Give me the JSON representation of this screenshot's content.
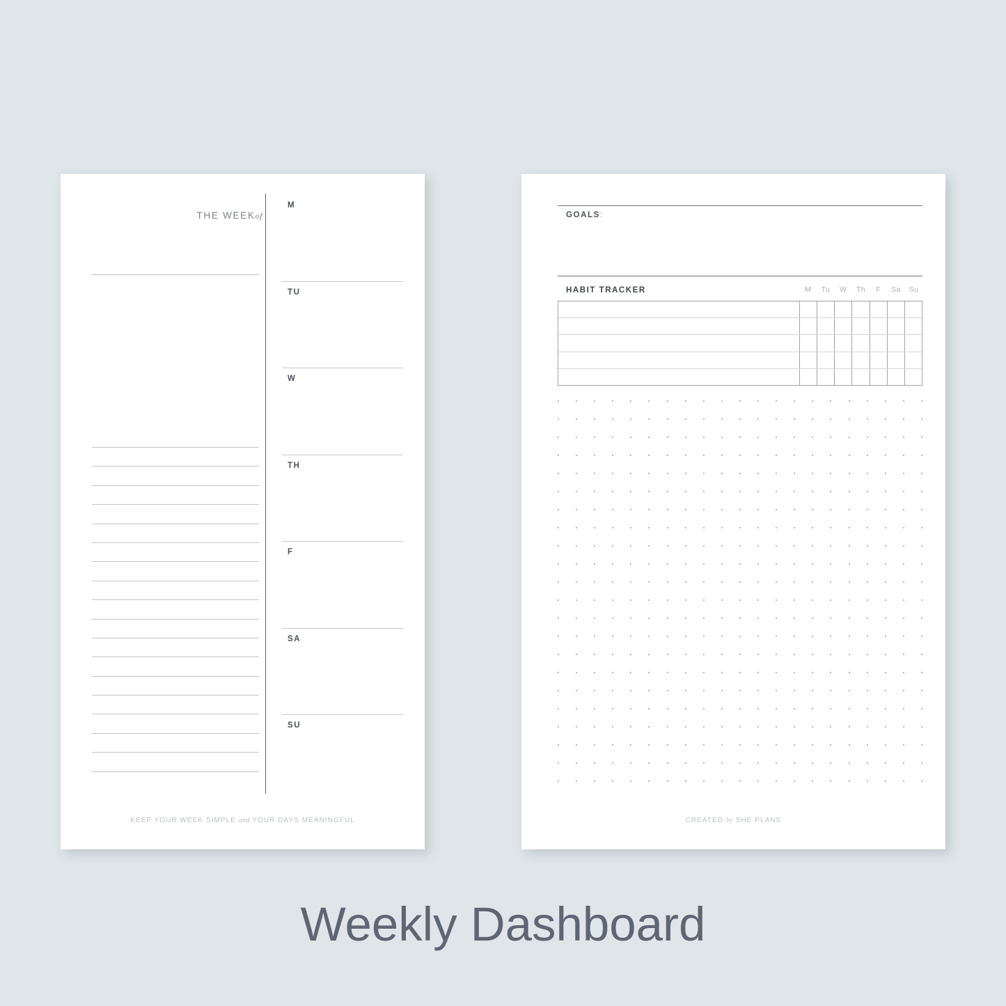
{
  "caption": "Weekly Dashboard",
  "theme": {
    "background": "#dfe5e8",
    "page": "#ffffff",
    "caption_color": "#5d6672",
    "rule_dark": "#6e7479",
    "rule_light": "#bfc4c7",
    "label_color": "#4b5058",
    "muted_color": "#babfc3"
  },
  "left_page": {
    "title_main": "THE WEEK",
    "title_italic": "of",
    "notes_line_count": 18,
    "days": [
      {
        "label": "M"
      },
      {
        "label": "TU"
      },
      {
        "label": "W"
      },
      {
        "label": "TH"
      },
      {
        "label": "F"
      },
      {
        "label": "SA"
      },
      {
        "label": "SU"
      }
    ],
    "footer": {
      "part1": "KEEP YOUR WEEK SIMPLE",
      "italic": "and",
      "part2": "YOUR DAYS MEANINGFUL"
    }
  },
  "right_page": {
    "goals_label": "GOALS",
    "goals_colon": ":",
    "habit_tracker_label": "HABIT TRACKER",
    "habit_days": [
      "M",
      "Tu",
      "W",
      "Th",
      "F",
      "Sa",
      "Su"
    ],
    "habit_row_count": 5,
    "dot_grid": {
      "columns": 21,
      "rows": 22
    },
    "footer": {
      "part1": "CREATED",
      "italic": "by",
      "part2": "SHE PLANS"
    }
  }
}
